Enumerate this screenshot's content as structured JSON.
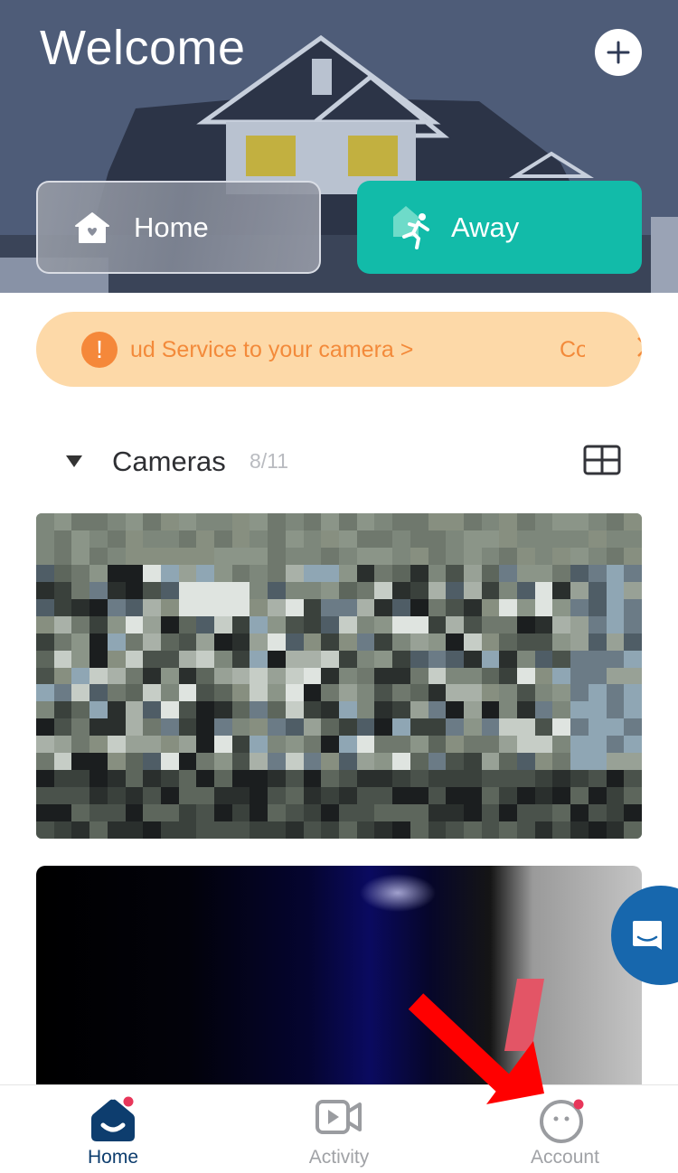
{
  "header": {
    "title": "Welcome",
    "add_button_icon": "plus-icon"
  },
  "modes": {
    "home": {
      "label": "Home",
      "icon": "house-heart-icon",
      "selected": false
    },
    "away": {
      "label": "Away",
      "icon": "running-person-icon",
      "selected": true
    },
    "colors": {
      "away_active": "#12bba9"
    }
  },
  "banner": {
    "icon": "exclamation-icon",
    "text": "ud Service to your camera >",
    "text_next": "Co",
    "chevron": "chevron-right-icon",
    "colors": {
      "background": "#fdd9a8",
      "text": "#f38a3a"
    }
  },
  "cameras": {
    "title": "Cameras",
    "count": "8/11",
    "collapse_icon": "triangle-down-icon",
    "layout_icon": "grid-view-icon",
    "feeds": [
      {
        "name": "camera-feed-1"
      },
      {
        "name": "camera-feed-2"
      }
    ]
  },
  "chat": {
    "icon": "chat-bubble-icon",
    "color": "#1767ad"
  },
  "tabbar": {
    "tabs": [
      {
        "label": "Home",
        "icon": "home-smile-icon",
        "active": true,
        "badge": true
      },
      {
        "label": "Activity",
        "icon": "video-camera-icon",
        "active": false,
        "badge": false
      },
      {
        "label": "Account",
        "icon": "account-face-icon",
        "active": false,
        "badge": true
      }
    ],
    "colors": {
      "active": "#0d3d6e",
      "inactive": "#a0a2a6",
      "badge": "#e8365a"
    }
  }
}
